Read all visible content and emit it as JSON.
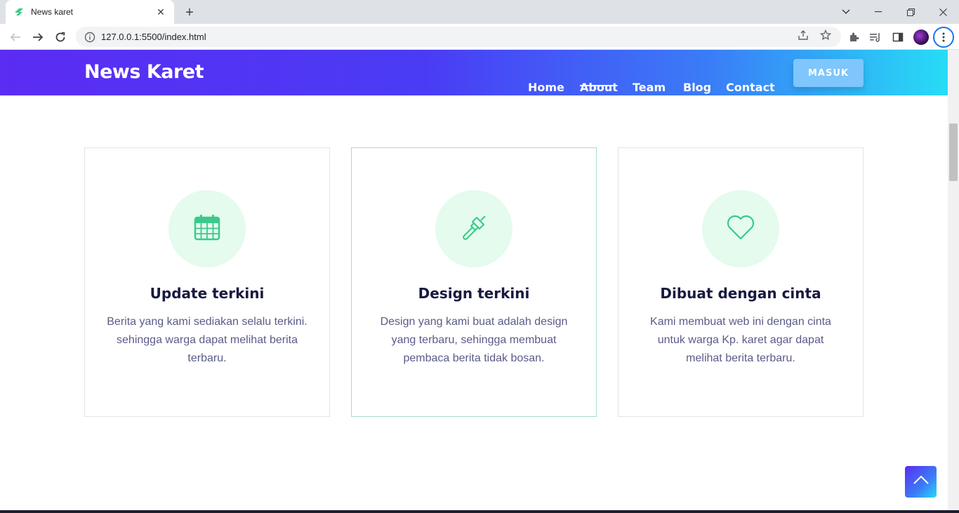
{
  "browser": {
    "tab_title": "News karet",
    "url": "127.0.0.1:5500/index.html"
  },
  "site": {
    "logo": "News Karet",
    "nav": [
      {
        "label": "Home"
      },
      {
        "label": "About",
        "active": true
      },
      {
        "label": "Team"
      },
      {
        "label": "Blog"
      },
      {
        "label": "Contact"
      }
    ],
    "login_button": "MASUK"
  },
  "features": [
    {
      "icon": "calendar-icon",
      "title": "Update terkini",
      "description": "Berita yang kami sediakan selalu terkini. sehingga warga dapat melihat berita terbaru."
    },
    {
      "icon": "brush-icon",
      "title": "Design terkini",
      "description": "Design yang kami buat adalah design yang terbaru, sehingga membuat pembaca berita tidak bosan."
    },
    {
      "icon": "heart-icon",
      "title": "Dibuat dengan cinta",
      "description": "Kami membuat web ini dengan cinta untuk warga Kp. karet agar dapat melihat berita terbaru."
    }
  ],
  "colors": {
    "header_gradient_start": "#5b2cf2",
    "header_gradient_end": "#27dcf6",
    "icon_green": "#3bc98a",
    "icon_bg": "#e4fbee",
    "title_text": "#17193f",
    "body_text": "#5b5b8a"
  }
}
